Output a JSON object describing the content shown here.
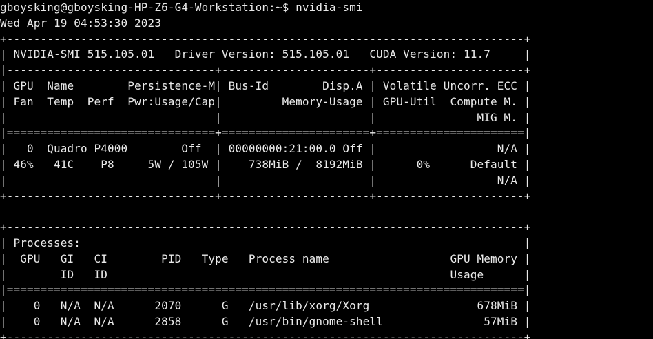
{
  "terminal": {
    "prompt_line": "gboysking@gboysking-HP-Z6-G4-Workstation:~$ nvidia-smi",
    "timestamp_line": "Wed Apr 19 04:53:30 2023",
    "lines": [
      "+-----------------------------------------------------------------------------+",
      "| NVIDIA-SMI 515.105.01   Driver Version: 515.105.01   CUDA Version: 11.7     |",
      "|-------------------------------+----------------------+----------------------+",
      "| GPU  Name        Persistence-M| Bus-Id        Disp.A | Volatile Uncorr. ECC |",
      "| Fan  Temp  Perf  Pwr:Usage/Cap|         Memory-Usage | GPU-Util  Compute M. |",
      "|                               |                      |               MIG M. |",
      "|===============================+======================+======================|",
      "|   0  Quadro P4000        Off  | 00000000:21:00.0 Off |                  N/A |",
      "| 46%   41C    P8     5W / 105W |    738MiB /  8192MiB |      0%      Default |",
      "|                               |                      |                  N/A |",
      "+-------------------------------+----------------------+----------------------+",
      "",
      "+-----------------------------------------------------------------------------+",
      "| Processes:                                                                  |",
      "|  GPU   GI   CI        PID   Type   Process name                  GPU Memory |",
      "|        ID   ID                                                   Usage      |",
      "|=============================================================================|",
      "|    0   N/A  N/A      2070      G   /usr/lib/xorg/Xorg                678MiB |",
      "|    0   N/A  N/A      2858      G   /usr/bin/gnome-shell               57MiB |",
      "+-----------------------------------------------------------------------------+"
    ]
  }
}
